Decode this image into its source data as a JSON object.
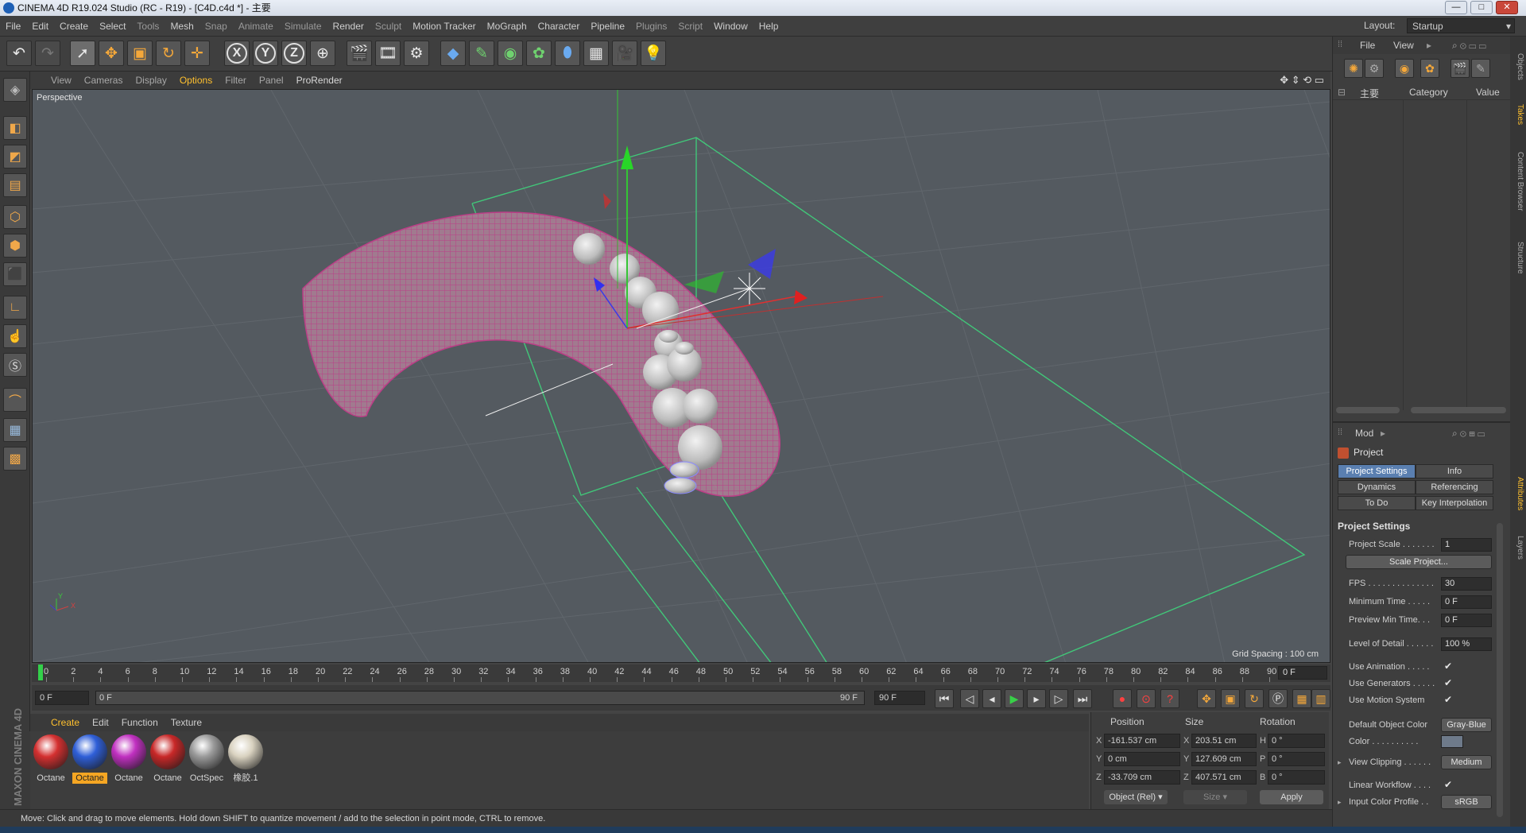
{
  "window": {
    "title": "CINEMA 4D R19.024 Studio (RC - R19) - [C4D.c4d *] - 主要",
    "min": "—",
    "max": "□",
    "close": "✕"
  },
  "menu": {
    "items": [
      "File",
      "Edit",
      "Create",
      "Select",
      "Tools",
      "Mesh",
      "Snap",
      "Animate",
      "Simulate",
      "Render",
      "Sculpt",
      "Motion Tracker",
      "MoGraph",
      "Character",
      "Pipeline",
      "Plugins",
      "Script",
      "Window",
      "Help"
    ],
    "layout_label": "Layout:",
    "layout_value": "Startup"
  },
  "viewport_menu": {
    "items": [
      "View",
      "Cameras",
      "Display",
      "Options",
      "Filter",
      "Panel",
      "ProRender"
    ],
    "camera_label": "Perspective",
    "grid_spacing": "Grid Spacing : 100 cm"
  },
  "timeline": {
    "ticks": [
      "0",
      "2",
      "4",
      "6",
      "8",
      "10",
      "12",
      "14",
      "16",
      "18",
      "20",
      "22",
      "24",
      "26",
      "28",
      "30",
      "32",
      "34",
      "36",
      "38",
      "40",
      "42",
      "44",
      "46",
      "48",
      "50",
      "52",
      "54",
      "56",
      "58",
      "60",
      "62",
      "64",
      "66",
      "68",
      "70",
      "72",
      "74",
      "76",
      "78",
      "80",
      "82",
      "84",
      "86",
      "88",
      "90"
    ],
    "current_frame": "0 F",
    "start_field": "0 F",
    "range_start": "0 F",
    "range_end": "90 F",
    "end_field": "90 F"
  },
  "material_manager": {
    "menu": [
      "Create",
      "Edit",
      "Function",
      "Texture"
    ],
    "materials": [
      {
        "name": "Octane",
        "color": "#d43030",
        "selected": false
      },
      {
        "name": "Octane",
        "color": "#2f5fd8",
        "selected": true
      },
      {
        "name": "Octane",
        "color": "#c030c0",
        "selected": false
      },
      {
        "name": "Octane",
        "color": "#c82828",
        "selected": false
      },
      {
        "name": "OctSpec",
        "color": "#9a9a9a",
        "selected": false
      },
      {
        "name": "橡胶.1",
        "color": "#d9d2c0",
        "selected": false
      }
    ],
    "brand": "MAXON CINEMA 4D"
  },
  "coordinates": {
    "headers": {
      "position": "Position",
      "size": "Size",
      "rotation": "Rotation"
    },
    "rows": [
      {
        "axis": "X",
        "pos": "-161.537 cm",
        "saxis": "X",
        "size": "203.51 cm",
        "raxis": "H",
        "rot": "0 °"
      },
      {
        "axis": "Y",
        "pos": "0 cm",
        "saxis": "Y",
        "size": "127.609 cm",
        "raxis": "P",
        "rot": "0 °"
      },
      {
        "axis": "Z",
        "pos": "-33.709 cm",
        "saxis": "Z",
        "size": "407.571 cm",
        "raxis": "B",
        "rot": "0 °"
      }
    ],
    "mode": "Object (Rel)",
    "size_mode": "Size",
    "apply": "Apply"
  },
  "status": "Move: Click and drag to move elements. Hold down SHIFT to quantize movement / add to the selection in point mode, CTRL to remove.",
  "object_manager": {
    "menu": [
      "File",
      "View"
    ],
    "columns": {
      "name": "主要",
      "category": "Category",
      "value": "Value"
    }
  },
  "side_tabs": [
    "Objects",
    "Takes",
    "Content Browser",
    "Structure",
    "Attributes",
    "Layers"
  ],
  "attributes": {
    "mode": "Mod",
    "title": "Project",
    "tabs": [
      "Project Settings",
      "Info",
      "Dynamics",
      "Referencing",
      "To Do",
      "Key Interpolation"
    ],
    "section": "Project Settings",
    "project_scale_label": "Project Scale . . . . . . .",
    "project_scale": "1",
    "scale_project": "Scale Project...",
    "fps_label": "FPS . . . . . . . . . . . . . .",
    "fps": "30",
    "min_time_label": "Minimum Time . . . . .",
    "min_time": "0 F",
    "preview_min_label": "Preview Min Time. . .",
    "preview_min": "0 F",
    "lod_label": "Level of Detail . . . . . .",
    "lod": "100 %",
    "use_animation_label": "Use Animation . . . . .",
    "use_generators_label": "Use Generators . . . . .",
    "use_motion_label": "Use Motion System",
    "check": "✔",
    "default_color_label": "Default Object Color",
    "default_color": "Gray-Blue",
    "color_label": "Color . . . . . . . . . .",
    "view_clipping_label": "View Clipping . . . . . .",
    "view_clipping": "Medium",
    "linear_workflow_label": "Linear Workflow . . . .",
    "input_profile_label": "Input Color Profile . .",
    "input_profile": "sRGB"
  }
}
